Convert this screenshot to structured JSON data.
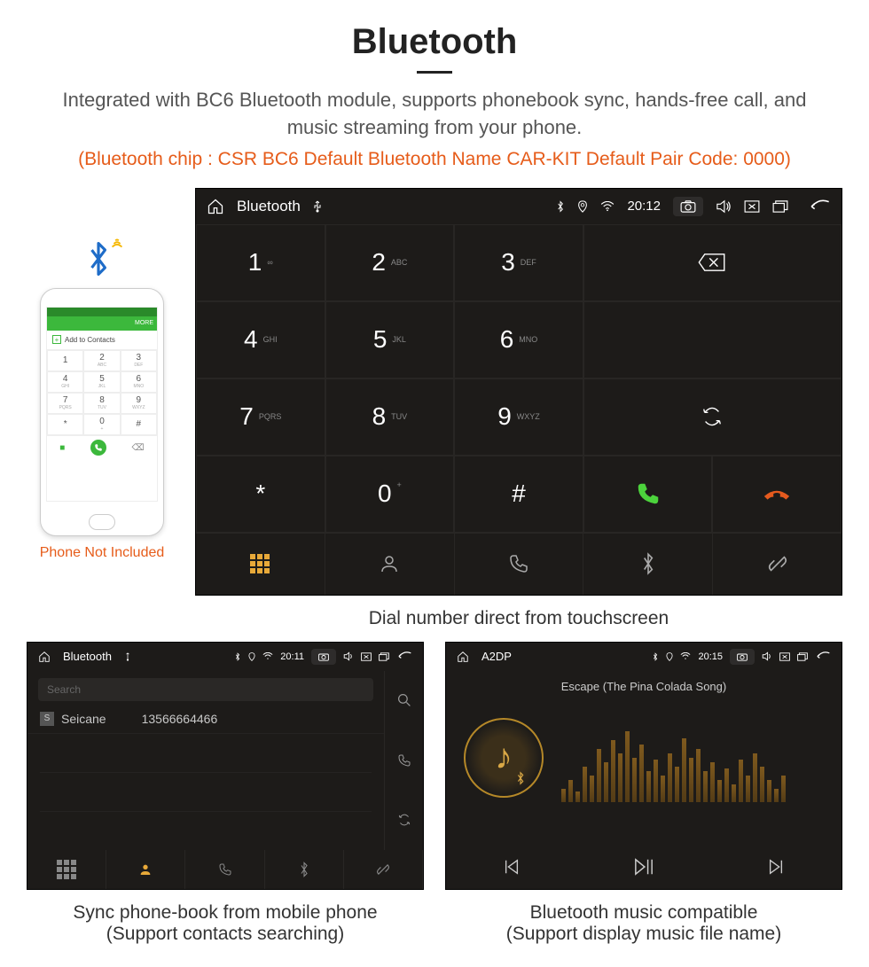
{
  "header": {
    "title": "Bluetooth",
    "desc": "Integrated with BC6 Bluetooth module, supports phonebook sync, hands-free call, and music streaming from your phone.",
    "spec": "(Bluetooth chip : CSR BC6    Default Bluetooth Name CAR-KIT    Default Pair Code: 0000)"
  },
  "phone": {
    "more": "MORE",
    "add_contacts": "Add to Contacts",
    "keys": [
      {
        "n": "1",
        "s": ""
      },
      {
        "n": "2",
        "s": "ABC"
      },
      {
        "n": "3",
        "s": "DEF"
      },
      {
        "n": "4",
        "s": "GHI"
      },
      {
        "n": "5",
        "s": "JKL"
      },
      {
        "n": "6",
        "s": "MNO"
      },
      {
        "n": "7",
        "s": "PQRS"
      },
      {
        "n": "8",
        "s": "TUV"
      },
      {
        "n": "9",
        "s": "WXYZ"
      },
      {
        "n": "*",
        "s": ""
      },
      {
        "n": "0",
        "s": "+"
      },
      {
        "n": "#",
        "s": ""
      }
    ],
    "caption": "Phone Not Included"
  },
  "main_shot": {
    "title": "Bluetooth",
    "time": "20:12",
    "keys": [
      {
        "n": "1",
        "s": "∞"
      },
      {
        "n": "2",
        "s": "ABC"
      },
      {
        "n": "3",
        "s": "DEF"
      },
      {
        "n": "4",
        "s": "GHI"
      },
      {
        "n": "5",
        "s": "JKL"
      },
      {
        "n": "6",
        "s": "MNO"
      },
      {
        "n": "7",
        "s": "PQRS"
      },
      {
        "n": "8",
        "s": "TUV"
      },
      {
        "n": "9",
        "s": "WXYZ"
      },
      {
        "n": "*",
        "s": ""
      },
      {
        "n": "0",
        "s": "+",
        "top": true
      },
      {
        "n": "#",
        "s": ""
      }
    ],
    "caption": "Dial number direct from touchscreen"
  },
  "contacts_shot": {
    "title": "Bluetooth",
    "time": "20:11",
    "search_placeholder": "Search",
    "contact_badge": "S",
    "contact_name": "Seicane",
    "contact_number": "13566664466",
    "caption1": "Sync phone-book from mobile phone",
    "caption2": "(Support contacts searching)"
  },
  "music_shot": {
    "title": "A2DP",
    "time": "20:15",
    "song": "Escape (The Pina Colada Song)",
    "caption1": "Bluetooth music compatible",
    "caption2": "(Support display music file name)"
  }
}
